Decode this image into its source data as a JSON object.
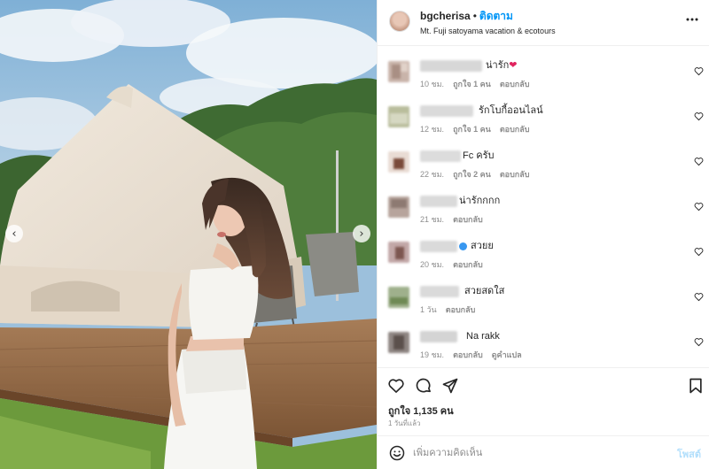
{
  "post": {
    "username": "bgcherisa",
    "separator": "•",
    "follow_label": "ติดตาม",
    "location": "Mt. Fuji satoyama vacation & ecotours",
    "more_icon": "more-horizontal-icon"
  },
  "media": {
    "prev_arrow": "‹",
    "next_arrow": "›"
  },
  "comments": [
    {
      "text": "น่ารัก",
      "emoji": "❤",
      "time": "10 ชม.",
      "likes": "ถูกใจ 1 คน",
      "reply": "ตอบกลับ",
      "translate": ""
    },
    {
      "text": "รักโบกี้ออนไลน์",
      "emoji": "",
      "time": "12 ชม.",
      "likes": "ถูกใจ 1 คน",
      "reply": "ตอบกลับ",
      "translate": ""
    },
    {
      "text": "Fc ครับ",
      "emoji": "",
      "time": "22 ชม.",
      "likes": "ถูกใจ 2 คน",
      "reply": "ตอบกลับ",
      "translate": ""
    },
    {
      "text": "น่ารักกกก",
      "emoji": "",
      "time": "21 ชม.",
      "likes": "",
      "reply": "ตอบกลับ",
      "translate": ""
    },
    {
      "text": "สวยย",
      "emoji": "",
      "time": "20 ชม.",
      "likes": "",
      "reply": "ตอบกลับ",
      "translate": "",
      "verified": true
    },
    {
      "text": "สวยสดใส",
      "emoji": "",
      "time": "1 วัน",
      "likes": "",
      "reply": "ตอบกลับ",
      "translate": ""
    },
    {
      "text": "Na rakk",
      "emoji": "",
      "time": "19 ชม.",
      "likes": "",
      "reply": "ตอบกลับ",
      "translate": "ดูคำแปล"
    }
  ],
  "actions": {
    "likes_count": "ถูกใจ 1,135 คน",
    "time_ago": "1 วันที่แล้ว"
  },
  "add_comment": {
    "placeholder": "เพิ่มความคิดเห็น",
    "post_label": "โพสต์"
  },
  "colors": {
    "accent": "#0095f6",
    "post_disabled": "#b2dffc",
    "heart": "#e0245e",
    "verified": "#3897f0"
  }
}
